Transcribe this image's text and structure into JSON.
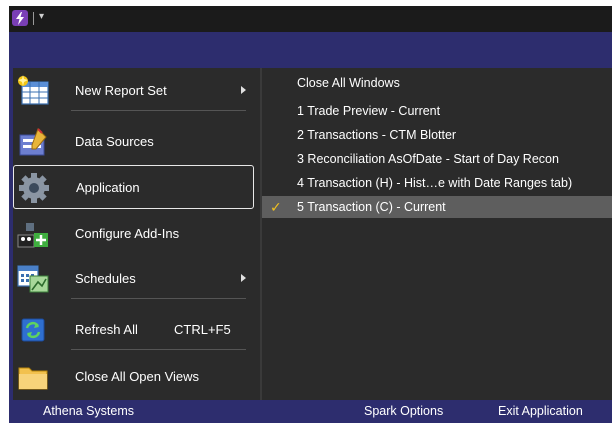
{
  "window": {
    "app_icon": "spark-lightning-icon",
    "quick_access_arrow": "▾"
  },
  "menu": {
    "items": [
      {
        "label": "New Report Set",
        "icon": "spreadsheet-new-icon",
        "has_submenu": true
      },
      {
        "label": "Data Sources",
        "icon": "data-sources-icon",
        "has_submenu": false
      },
      {
        "label": "Application",
        "icon": "gear-icon",
        "has_submenu": false,
        "selected": true
      },
      {
        "label": "Configure Add-Ins",
        "icon": "add-ins-icon",
        "has_submenu": false
      },
      {
        "label": "Schedules",
        "icon": "calendar-icon",
        "has_submenu": true
      },
      {
        "label": "Refresh All",
        "shortcut": "CTRL+F5",
        "icon": "refresh-icon",
        "has_submenu": false
      },
      {
        "label": "Close All Open Views",
        "icon": "folder-icon",
        "has_submenu": false
      }
    ]
  },
  "recent": {
    "close_all": "Close All Windows",
    "windows": [
      {
        "label": "1 Trade Preview - Current"
      },
      {
        "label": "2 Transactions - CTM Blotter"
      },
      {
        "label": "3 Reconciliation AsOfDate - Start of Day Recon"
      },
      {
        "label": "4 Transaction (H) - Hist…e with Date Ranges tab)"
      },
      {
        "label": "5 Transaction (C) - Current",
        "checked": true,
        "check": "✓"
      }
    ]
  },
  "footer": {
    "company": "Athena Systems",
    "spark_options": "Spark Options",
    "exit": "Exit Application"
  },
  "colors": {
    "band": "#2d2d6e",
    "menu_bg": "#2b2b2b",
    "selected_row": "#5e5e5e",
    "check": "#f0c020"
  }
}
